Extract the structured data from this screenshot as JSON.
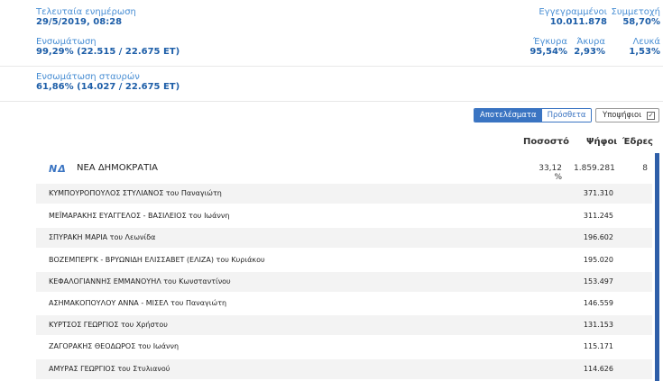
{
  "last_update": {
    "label": "Τελευταία ενημέρωση",
    "value": "29/5/2019, 08:28"
  },
  "integration": {
    "label": "Ενσωμάτωση",
    "value": "99,29% (22.515 / 22.675 ΕΤ)"
  },
  "cross_integration": {
    "label": "Ενσωμάτωση σταυρών",
    "value": "61,86% (14.027 / 22.675 ΕΤ)"
  },
  "stats": {
    "registered": {
      "label": "Εγγεγραμμένοι",
      "value": "10.011.878"
    },
    "turnout": {
      "label": "Συμμετοχή",
      "value": "58,70%"
    },
    "valid": {
      "label": "Έγκυρα",
      "value": "95,54%"
    },
    "invalid": {
      "label": "Άκυρα",
      "value": "2,93%"
    },
    "blank": {
      "label": "Λευκά",
      "value": "1,53%"
    }
  },
  "toggle": {
    "results": "Αποτελέσματα",
    "additional": "Πρόσθετα"
  },
  "candidates_button": {
    "label": "Υποψήφιοι",
    "check": "✓"
  },
  "columns": {
    "percent": "Ποσοστό",
    "votes": "Ψήφοι",
    "seats": "Έδρες"
  },
  "party": {
    "logo": "ΝΔ",
    "name": "ΝΕΑ ΔΗΜΟΚΡΑΤΙΑ",
    "percent": "33,12 %",
    "votes": "1.859.281",
    "seats": "8"
  },
  "candidates": [
    {
      "name": "ΚΥΜΠΟΥΡΟΠΟΥΛΟΣ ΣΤΥΛΙΑΝΟΣ του Παναγιώτη",
      "votes": "371.310"
    },
    {
      "name": "ΜΕΪΜΑΡΑΚΗΣ ΕΥΑΓΓΕΛΟΣ - ΒΑΣΙΛΕΙΟΣ του Ιωάννη",
      "votes": "311.245"
    },
    {
      "name": "ΣΠΥΡΑΚΗ ΜΑΡΙΑ του Λεωνίδα",
      "votes": "196.602"
    },
    {
      "name": "ΒΟΖΕΜΠΕΡΓΚ - ΒΡΥΩΝΙΔΗ ΕΛΙΣΣΑΒΕΤ (ΕΛΙΖΑ) του Κυριάκου",
      "votes": "195.020"
    },
    {
      "name": "ΚΕΦΑΛΟΓΙΑΝΝΗΣ ΕΜΜΑΝΟΥΗΛ του Κωνσταντίνου",
      "votes": "153.497"
    },
    {
      "name": "ΑΣΗΜΑΚΟΠΟΥΛΟΥ ΑΝΝΑ - ΜΙΣΕΛ του Παναγιώτη",
      "votes": "146.559"
    },
    {
      "name": "ΚΥΡΤΣΟΣ ΓΕΩΡΓΙΟΣ του Χρήστου",
      "votes": "131.153"
    },
    {
      "name": "ΖΑΓΟΡΑΚΗΣ ΘΕΟΔΩΡΟΣ του Ιωάννη",
      "votes": "115.171"
    },
    {
      "name": "ΑΜΥΡΑΣ ΓΕΩΡΓΙΟΣ του Στυλιανού",
      "votes": "114.626"
    }
  ]
}
